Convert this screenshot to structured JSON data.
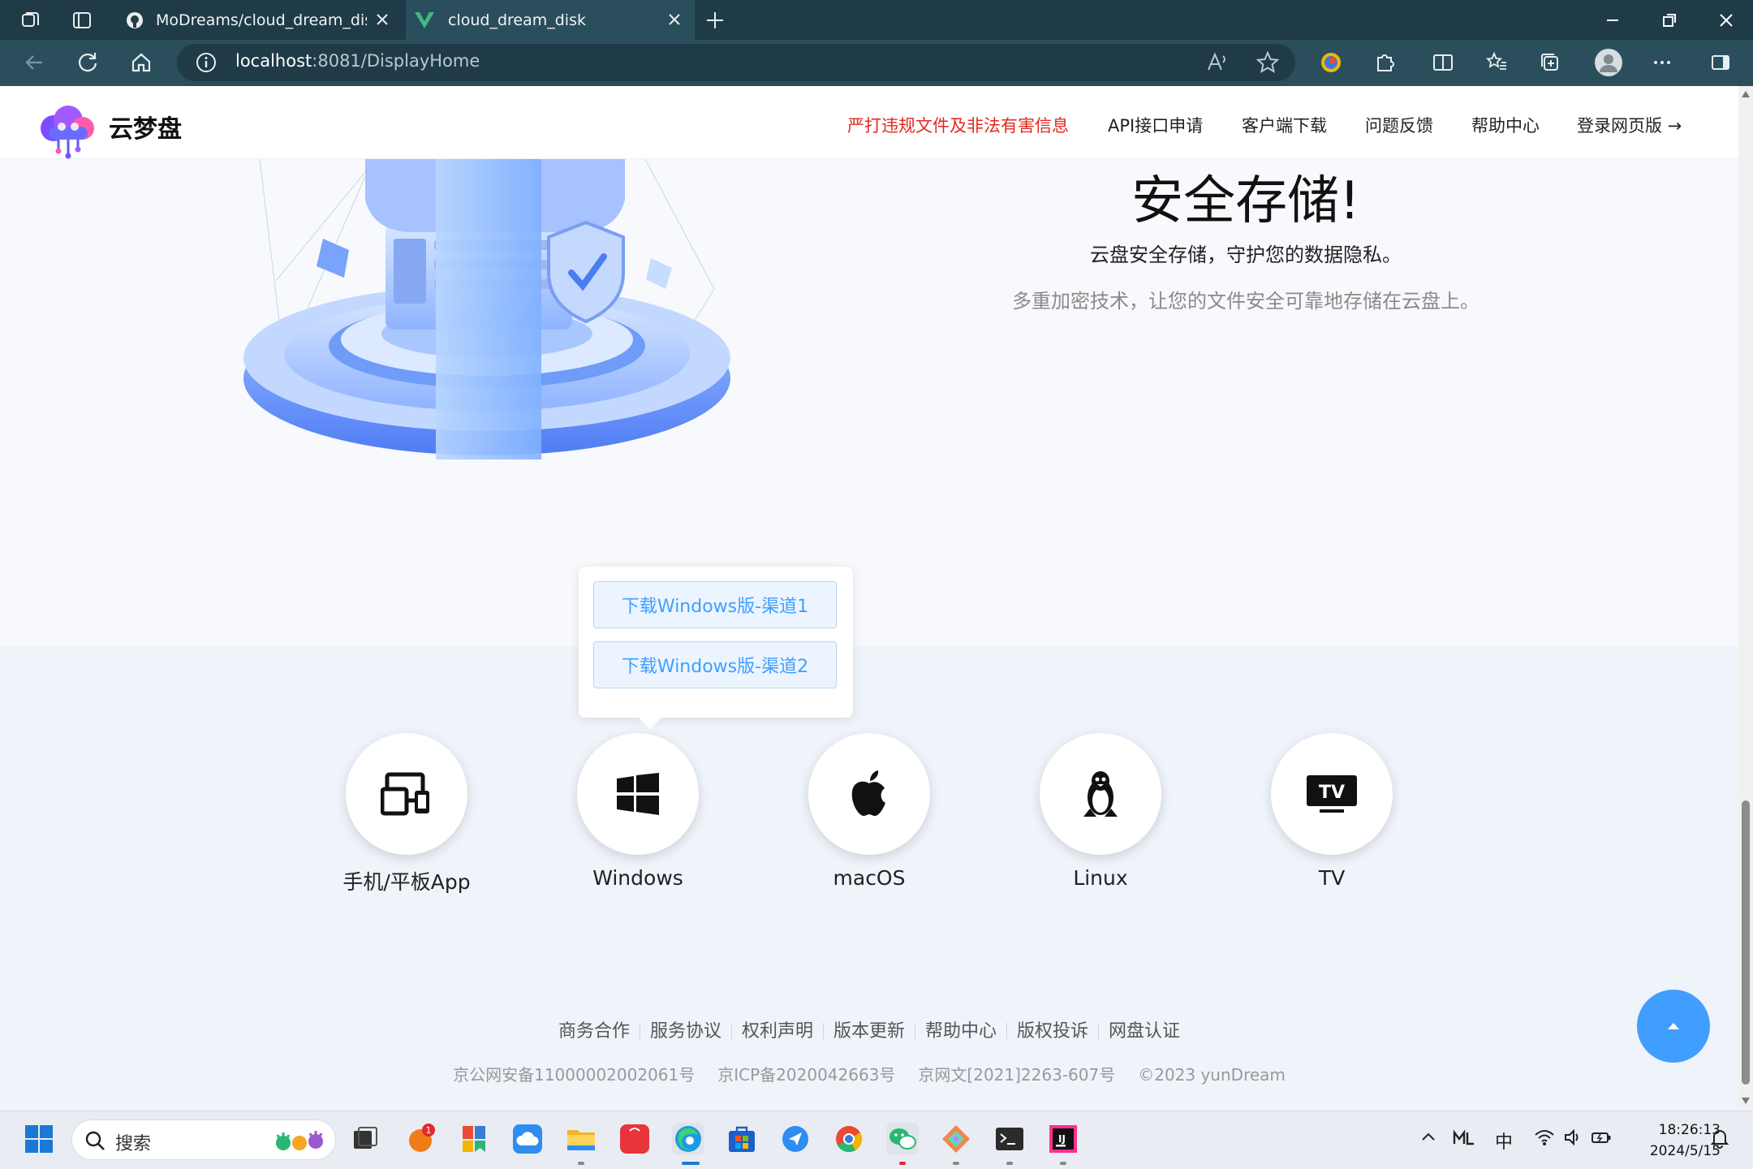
{
  "browser": {
    "tabs": [
      {
        "title": "MoDreams/cloud_dream_disk: ·",
        "icon": "github-icon",
        "active": false
      },
      {
        "title": "cloud_dream_disk",
        "icon": "vue-icon",
        "active": true
      }
    ],
    "url_host": "localhost",
    "url_rest": ":8081/DisplayHome"
  },
  "header": {
    "logo_text": "云梦盘",
    "nav": [
      {
        "label": "严打违规文件及非法有害信息",
        "color": "#e4281e"
      },
      {
        "label": "API接口申请"
      },
      {
        "label": "客户端下载"
      },
      {
        "label": "问题反馈"
      },
      {
        "label": "帮助中心"
      },
      {
        "label": "登录网页版 →"
      }
    ]
  },
  "hero": {
    "title": "安全存储!",
    "subtitle": "云盘安全存储，守护您的数据隐私。",
    "description": "多重加密技术，让您的文件安全可靠地存储在云盘上。"
  },
  "download_popover": {
    "buttons": [
      "下载Windows版-渠道1",
      "下载Windows版-渠道2"
    ]
  },
  "platforms": [
    {
      "label": "手机/平板App",
      "icon": "mobile-tablet-icon"
    },
    {
      "label": "Windows",
      "icon": "windows-icon"
    },
    {
      "label": "macOS",
      "icon": "apple-icon"
    },
    {
      "label": "Linux",
      "icon": "linux-tux-icon"
    },
    {
      "label": "TV",
      "icon": "tv-icon"
    }
  ],
  "footer": {
    "links": [
      "商务合作",
      "服务协议",
      "权利声明",
      "版本更新",
      "帮助中心",
      "版权投诉",
      "网盘认证"
    ],
    "copyright": [
      "京公网安备11000002002061号",
      "京ICP备2020042663号",
      "京网文[2021]2263-607号",
      "©2023 yunDream"
    ]
  },
  "taskbar": {
    "search_placeholder": "搜索",
    "time": "18:26:13",
    "date": "2024/5/15",
    "ime": "中",
    "badge_count": "1"
  },
  "colors": {
    "accent": "#409eff",
    "warn": "#e4281e",
    "chrome_dark": "#1f3b48",
    "chrome": "#2b4e5d"
  }
}
